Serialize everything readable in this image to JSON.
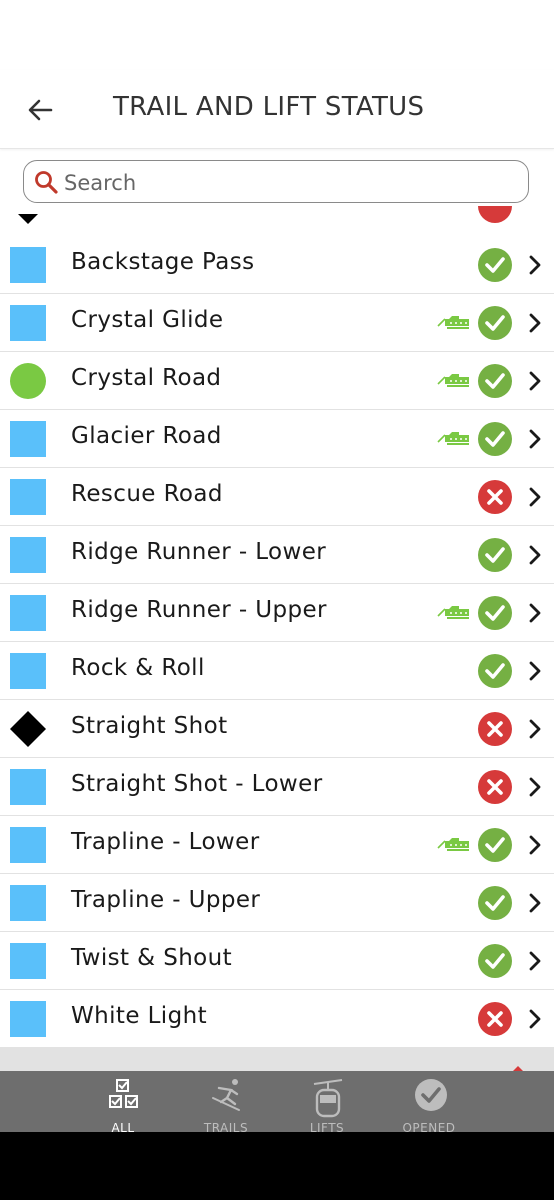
{
  "header": {
    "title": "TRAIL AND LIFT STATUS"
  },
  "search": {
    "placeholder": "Search",
    "value": ""
  },
  "colors": {
    "blue_square": "#5ac0fa",
    "green_circle": "#7ac943",
    "black_diamond": "#000000",
    "open_green": "#75b043",
    "closed_red": "#d63a3a",
    "groomed_green": "#7ac943",
    "tabbar": "#6e6e6e"
  },
  "trails": [
    {
      "name": "Backstage Pass",
      "difficulty": "blue-square",
      "groomed": false,
      "status": "open"
    },
    {
      "name": "Crystal Glide",
      "difficulty": "blue-square",
      "groomed": true,
      "status": "open"
    },
    {
      "name": "Crystal Road",
      "difficulty": "green-circle",
      "groomed": true,
      "status": "open"
    },
    {
      "name": "Glacier Road",
      "difficulty": "blue-square",
      "groomed": true,
      "status": "open"
    },
    {
      "name": "Rescue Road",
      "difficulty": "blue-square",
      "groomed": false,
      "status": "closed"
    },
    {
      "name": "Ridge Runner - Lower",
      "difficulty": "blue-square",
      "groomed": false,
      "status": "open"
    },
    {
      "name": "Ridge Runner - Upper",
      "difficulty": "blue-square",
      "groomed": true,
      "status": "open"
    },
    {
      "name": "Rock & Roll",
      "difficulty": "blue-square",
      "groomed": false,
      "status": "open"
    },
    {
      "name": "Straight Shot",
      "difficulty": "black-diamond",
      "groomed": false,
      "status": "closed"
    },
    {
      "name": "Straight Shot - Lower",
      "difficulty": "blue-square",
      "groomed": false,
      "status": "closed"
    },
    {
      "name": "Trapline - Lower",
      "difficulty": "blue-square",
      "groomed": true,
      "status": "open"
    },
    {
      "name": "Trapline - Upper",
      "difficulty": "blue-square",
      "groomed": false,
      "status": "open"
    },
    {
      "name": "Twist & Shout",
      "difficulty": "blue-square",
      "groomed": false,
      "status": "open"
    },
    {
      "name": "White Light",
      "difficulty": "blue-square",
      "groomed": false,
      "status": "closed"
    }
  ],
  "tabs": [
    {
      "label": "ALL",
      "icon": "checklist-icon",
      "active": true
    },
    {
      "label": "TRAILS",
      "icon": "skier-icon",
      "active": false
    },
    {
      "label": "LIFTS",
      "icon": "gondola-icon",
      "active": false
    },
    {
      "label": "OPENED",
      "icon": "check-circle-icon",
      "active": false
    }
  ]
}
